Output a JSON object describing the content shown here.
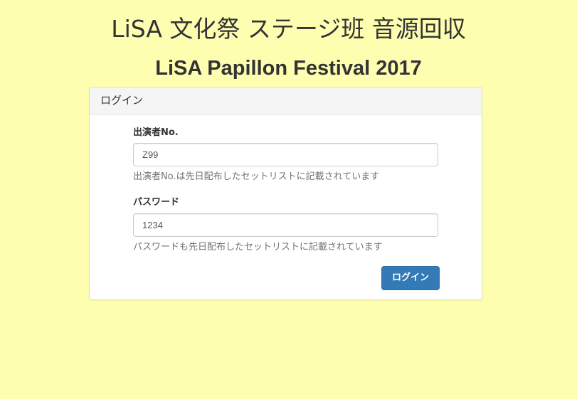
{
  "header": {
    "title": "LiSA 文化祭 ステージ班 音源回収",
    "subtitle": "LiSA Papillon Festival 2017"
  },
  "panel": {
    "heading": "ログイン"
  },
  "form": {
    "performer": {
      "label": "出演者No.",
      "value": "Z99",
      "help": "出演者No.は先日配布したセットリストに記載されています"
    },
    "password": {
      "label": "パスワード",
      "value": "1234",
      "help": "パスワードも先日配布したセットリストに記載されています"
    },
    "submit_label": "ログイン"
  },
  "colors": {
    "background": "#fdfeb0",
    "primary_button": "#337ab7"
  }
}
